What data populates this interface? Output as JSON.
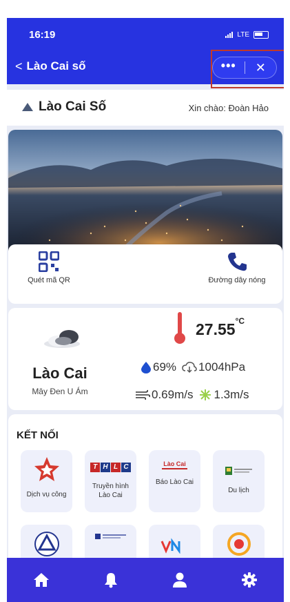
{
  "status": {
    "time": "16:19",
    "network": "LTE"
  },
  "nav": {
    "back_glyph": "<",
    "title": "Lào Cai số",
    "more_glyph": "•••",
    "close_glyph": "✕"
  },
  "app": {
    "brand": "Lào Cai Số",
    "greeting": "Xin chào: Đoàn Hảo"
  },
  "quick_actions": [
    {
      "label": "Quét mã QR",
      "icon": "qr-code-icon"
    },
    {
      "label": "Đường dây nóng",
      "icon": "phone-icon"
    }
  ],
  "weather": {
    "city": "Lào Cai",
    "description": "Mây Đen U Ám",
    "temperature": "27.55",
    "unit": "°C",
    "humidity": "69%",
    "pressure": "1004hPa",
    "wind": "0.69m/s",
    "gust": "1.3m/s"
  },
  "connect": {
    "title": "KẾT NỐI",
    "tiles": [
      {
        "label": "Dịch vụ công",
        "icon": "public-service-icon"
      },
      {
        "label": "Truyền hình Lào Cai",
        "icon": "thlc-logo-icon",
        "logo": [
          "T",
          "H",
          "L",
          "C"
        ]
      },
      {
        "label": "Báo Lào Cai",
        "icon": "bao-lao-cai-logo-icon",
        "logo_text": "Lào Cai"
      },
      {
        "label": "Du lịch",
        "icon": "tourism-logo-icon"
      },
      {
        "label": "",
        "icon": "laocai-emblem-icon"
      },
      {
        "label": "",
        "icon": "department-logo-icon"
      },
      {
        "label": "",
        "icon": "vneid-logo-icon"
      },
      {
        "label": "",
        "icon": "sun-emblem-icon"
      }
    ]
  },
  "tabbar": [
    {
      "icon": "home-icon"
    },
    {
      "icon": "bell-icon"
    },
    {
      "icon": "user-icon"
    },
    {
      "icon": "gear-icon"
    }
  ],
  "colors": {
    "primary": "#2733e0",
    "tabbar": "#3a32d8",
    "highlight": "#c0392b",
    "background": "#e9ecf6"
  }
}
